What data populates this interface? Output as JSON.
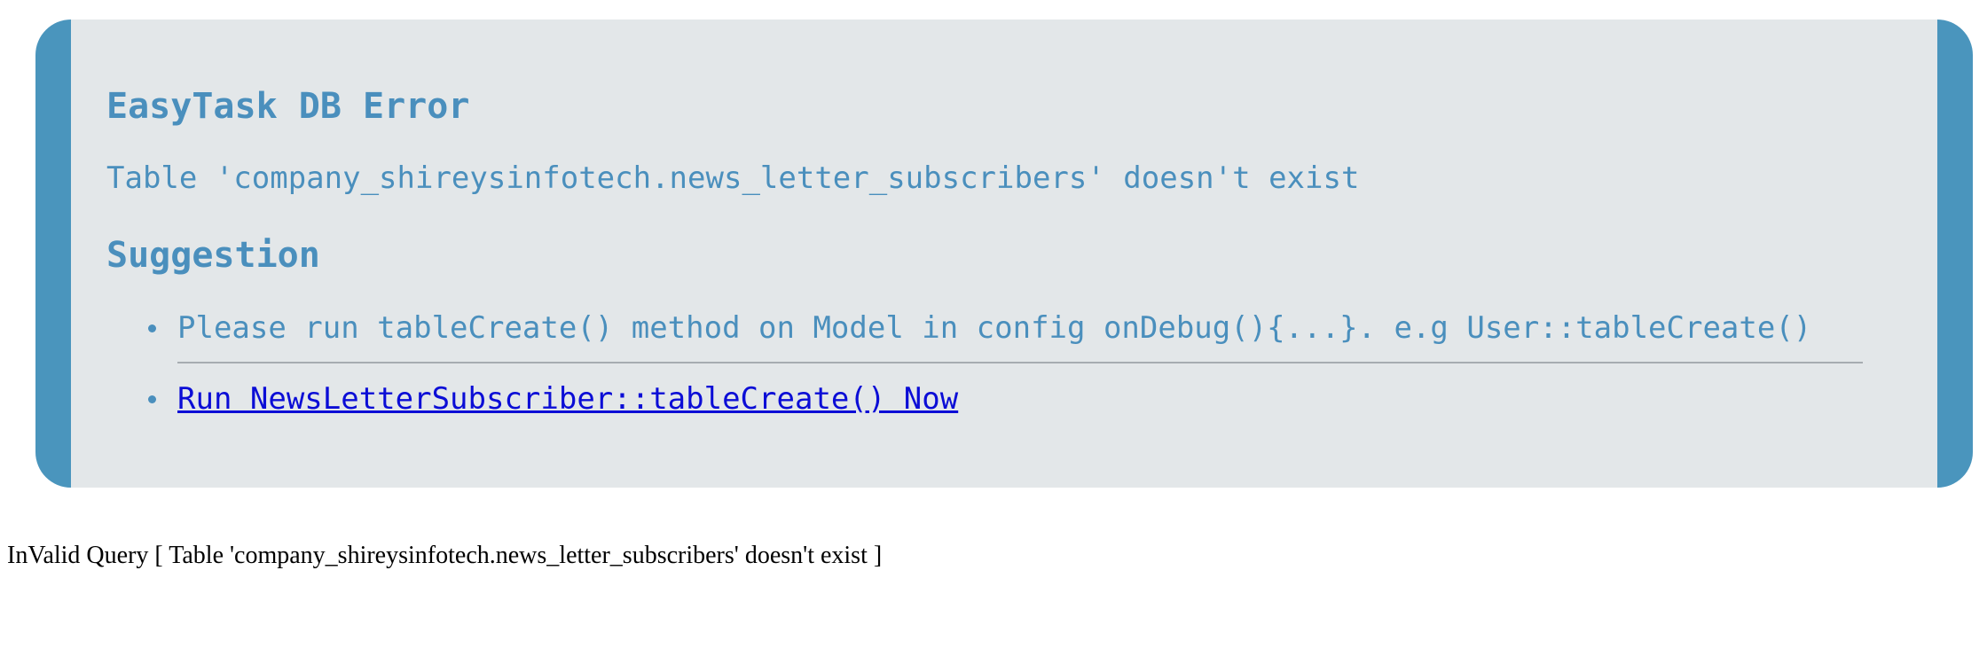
{
  "error_panel": {
    "title": "EasyTask DB Error",
    "message": "Table 'company_shireysinfotech.news_letter_subscribers' doesn't exist",
    "suggestion_heading": "Suggestion",
    "suggestions": [
      {
        "text": "Please run tableCreate() method on Model in config onDebug(){...}. e.g User::tableCreate()"
      },
      {
        "link_text": "Run NewsLetterSubscriber::tableCreate() Now"
      }
    ]
  },
  "footer": {
    "text": "InValid Query [ Table 'company_shireysinfotech.news_letter_subscribers' doesn't exist ]"
  },
  "colors": {
    "accent": "#4a95bd",
    "panel_background": "#e3e7e9",
    "link": "#0b0dd6"
  }
}
